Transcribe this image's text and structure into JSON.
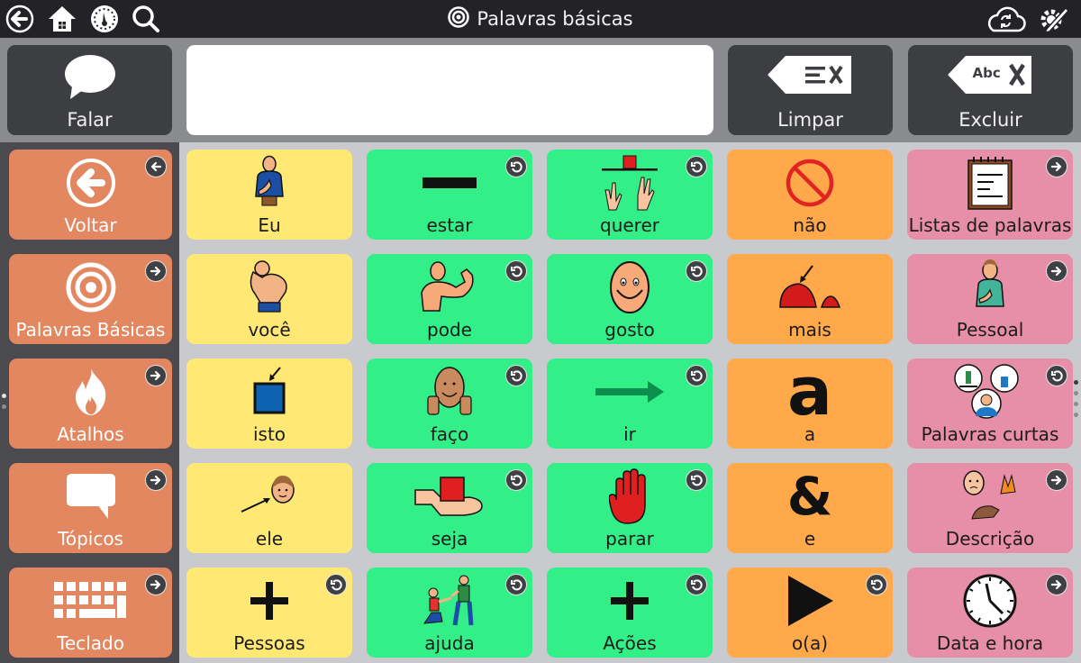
{
  "topbar": {
    "title": "Palavras básicas",
    "left_icons": [
      "back-icon",
      "home-icon",
      "dashboard-icon",
      "search-icon"
    ],
    "right_icons": [
      "cloud-sync-icon",
      "edit-settings-icon"
    ]
  },
  "message_bar": {
    "speak_label": "Falar",
    "message_text": "",
    "clear_label": "Limpar",
    "delete_label": "Excluir",
    "delete_icon_text": "Abc"
  },
  "colors": {
    "topbar": "#232226",
    "sidebar": "#4b4a4f",
    "navigation": "#e2875f",
    "pronoun": "#ffe874",
    "verb": "#33ef88",
    "function": "#ffa94a",
    "folder": "#e78ea8",
    "action_button": "#3d3e42"
  },
  "sidebar": {
    "items": [
      {
        "label": "Voltar",
        "icon": "back-arrow-icon",
        "badge": "back"
      },
      {
        "label": "Palavras Básicas",
        "icon": "target-icon",
        "badge": "link"
      },
      {
        "label": "Atalhos",
        "icon": "flame-icon",
        "badge": "link"
      },
      {
        "label": "Tópicos",
        "icon": "speech-bubble-icon",
        "badge": "link"
      },
      {
        "label": "Teclado",
        "icon": "keyboard-icon",
        "badge": "link"
      }
    ]
  },
  "grid": {
    "columns": [
      [
        {
          "label": "Eu",
          "icon": "person-pointing-self-icon",
          "category": "pronoun",
          "badge": null
        },
        {
          "label": "você",
          "icon": "pointing-finger-icon",
          "category": "pronoun",
          "badge": null
        },
        {
          "label": "isto",
          "icon": "blue-square-arrow-icon",
          "category": "pronoun",
          "badge": null
        },
        {
          "label": "ele",
          "icon": "boy-face-arrow-icon",
          "category": "pronoun",
          "badge": null
        },
        {
          "label": "Pessoas",
          "icon": "plus-icon",
          "category": "pronoun",
          "badge": "return"
        }
      ],
      [
        {
          "label": "estar",
          "icon": "bar-icon",
          "category": "verb",
          "badge": "return"
        },
        {
          "label": "pode",
          "icon": "flexing-arm-icon",
          "category": "verb",
          "badge": "return"
        },
        {
          "label": "faço",
          "icon": "thumbs-up-face-icon",
          "category": "verb",
          "badge": "return"
        },
        {
          "label": "seja",
          "icon": "hand-holding-cube-icon",
          "category": "verb",
          "badge": "return"
        },
        {
          "label": "ajuda",
          "icon": "people-helping-icon",
          "category": "verb",
          "badge": "return"
        }
      ],
      [
        {
          "label": "querer",
          "icon": "hands-reaching-icon",
          "category": "verb",
          "badge": "return"
        },
        {
          "label": "gosto",
          "icon": "smiling-face-icon",
          "category": "verb",
          "badge": "return"
        },
        {
          "label": "ir",
          "icon": "right-arrow-icon",
          "category": "verb",
          "badge": "return"
        },
        {
          "label": "parar",
          "icon": "stop-hand-icon",
          "category": "verb",
          "badge": "return"
        },
        {
          "label": "Ações",
          "icon": "plus-icon",
          "category": "verb",
          "badge": "return"
        }
      ],
      [
        {
          "label": "não",
          "icon": "prohibited-icon",
          "category": "function",
          "badge": null,
          "glyph": ""
        },
        {
          "label": "mais",
          "icon": "pile-more-icon",
          "category": "function",
          "badge": null,
          "glyph": ""
        },
        {
          "label": "a",
          "icon": "letter-a-icon",
          "category": "function",
          "badge": null,
          "glyph": "a"
        },
        {
          "label": "e",
          "icon": "ampersand-icon",
          "category": "function",
          "badge": null,
          "glyph": "&"
        },
        {
          "label": "o(a)",
          "icon": "play-triangle-icon",
          "category": "function",
          "badge": "return",
          "glyph": ""
        }
      ],
      [
        {
          "label": "Listas de palavras",
          "icon": "notepad-icon",
          "category": "folder",
          "badge": "link"
        },
        {
          "label": "Pessoal",
          "icon": "person-self-icon",
          "category": "folder",
          "badge": "link"
        },
        {
          "label": "Palavras curtas",
          "icon": "short-words-people-icon",
          "category": "folder",
          "badge": "return"
        },
        {
          "label": "Descrição",
          "icon": "describe-icon",
          "category": "folder",
          "badge": "link"
        },
        {
          "label": "Data e hora",
          "icon": "clock-icon",
          "category": "folder",
          "badge": "link"
        }
      ]
    ]
  },
  "pagination": {
    "left_pages": 2,
    "left_active": 0,
    "right_pages": 4,
    "right_active": 0
  }
}
